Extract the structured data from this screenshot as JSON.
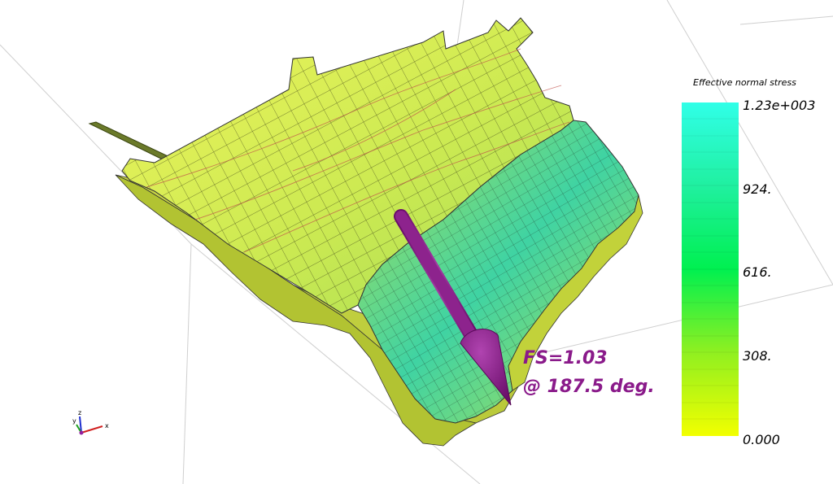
{
  "legend": {
    "title": "Effective normal stress",
    "ticks": [
      "1.23e+003",
      "924.",
      "616.",
      "308.",
      "0.000"
    ],
    "range": [
      0,
      1230
    ],
    "colors": {
      "low": "#f0ff00",
      "mid": "#00f050",
      "high": "#30ffe8"
    }
  },
  "annotation": {
    "line1": "FS=1.03",
    "line2": "@ 187.5 deg.",
    "color": "#8a1a8a"
  },
  "axes": {
    "x_label": "x",
    "y_label": "y",
    "z_label": "z"
  },
  "surface": {
    "outline_color": "#000000",
    "low_face": "#e6f050",
    "mid_face": "#a8e050",
    "high_face": "#30d0a0",
    "side_face": "#c8d040"
  }
}
